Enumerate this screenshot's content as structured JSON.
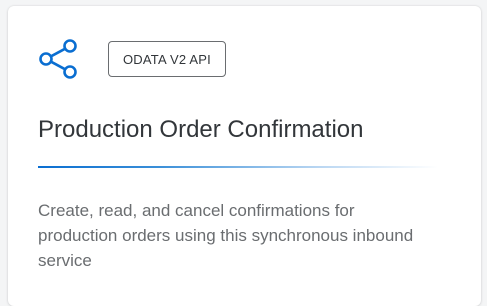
{
  "card": {
    "icon": "share-icon",
    "badge": "ODATA V2 API",
    "title": "Production Order Confirmation",
    "description": "Create, read, and cancel confirmations for production orders using this synchronous inbound service"
  },
  "colors": {
    "accent": "#0a6ed1",
    "title_text": "#32363a",
    "description_text": "#6a6d70",
    "badge_border": "#6a6d70"
  }
}
